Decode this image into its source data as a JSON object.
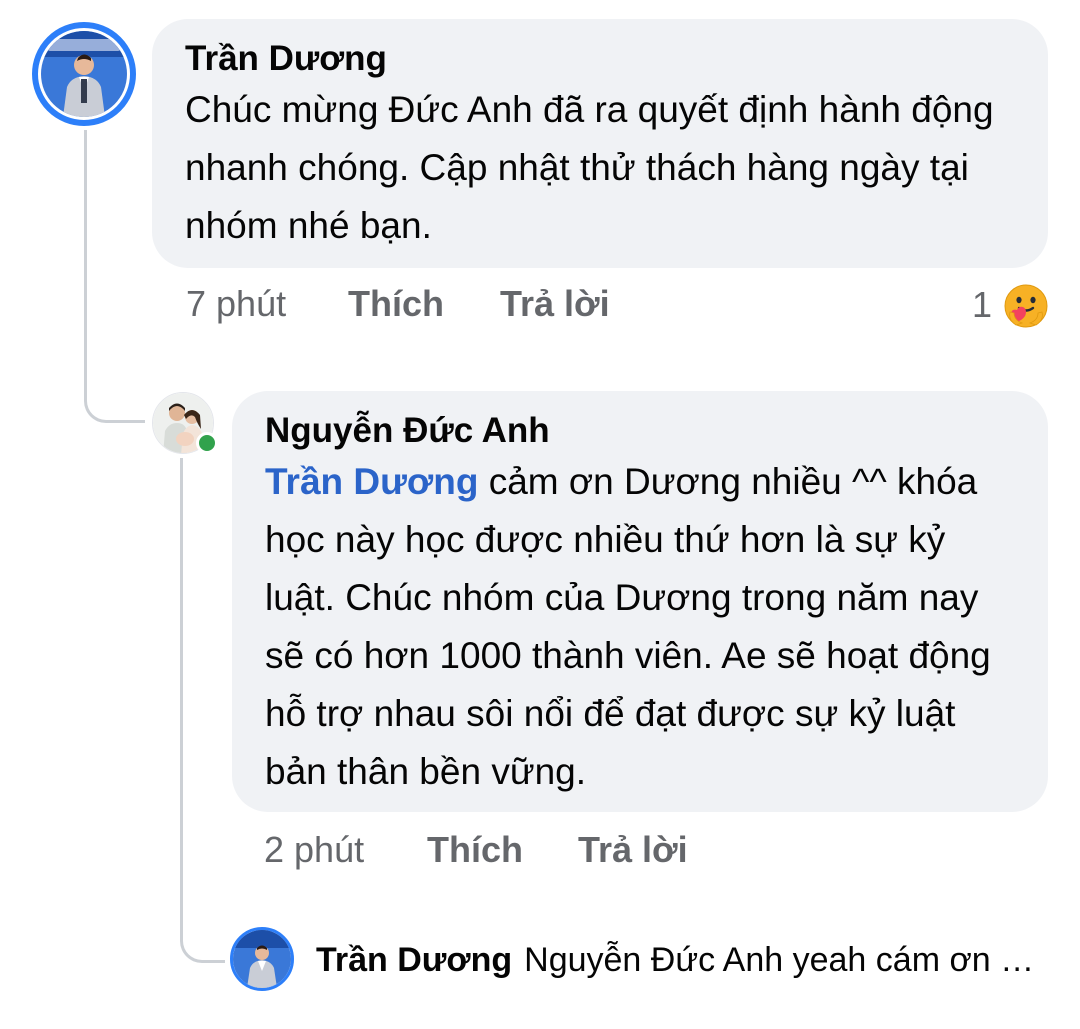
{
  "comment": {
    "author": "Trần Dương",
    "text": "Chúc mừng Đức Anh đã ra quyết định hành động nhanh chóng. Cập nhật thử thách hàng ngày tại nhóm nhé bạn.",
    "time": "7 phút",
    "like_label": "Thích",
    "reply_label": "Trả lời",
    "reaction_count": "1",
    "reaction_icon": "care-reaction-icon",
    "avatar_ring_color": "#2d7ff9"
  },
  "reply": {
    "author": "Nguyễn Đức Anh",
    "mention": "Trần Dương",
    "text": "cảm ơn Dương nhiều ^^ khóa học này học được nhiều thứ hơn là sự kỷ luật. Chúc nhóm của Dương trong năm nay sẽ có hơn 1000 thành viên. Ae sẽ hoạt động hỗ trợ nhau sôi nổi để đạt được sự kỷ luật bản thân bền vững.",
    "time": "2 phút",
    "like_label": "Thích",
    "reply_label": "Trả lời",
    "online_status_color": "#31a24c"
  },
  "collapsed_reply": {
    "author": "Trần Dương",
    "preview": "Nguyễn Đức Anh yeah cám ơn Đ..."
  }
}
